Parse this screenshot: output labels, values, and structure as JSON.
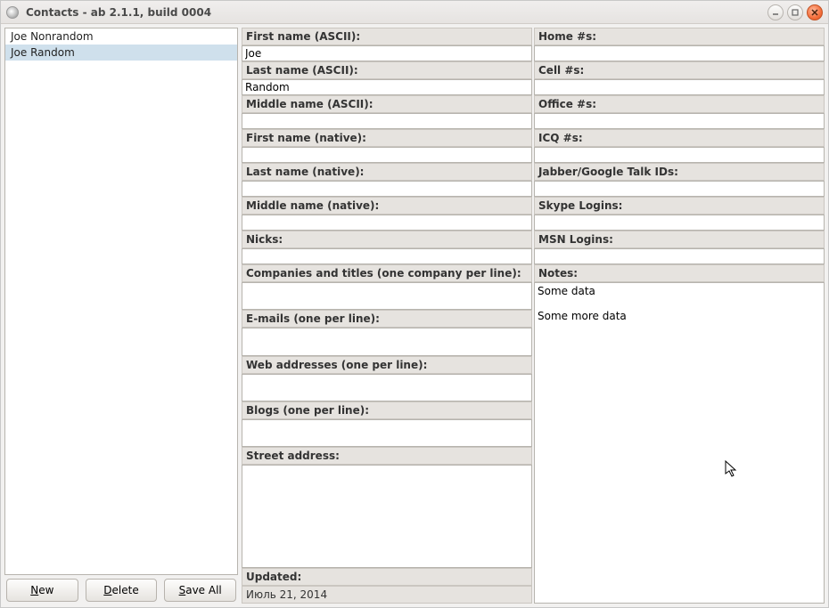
{
  "window": {
    "title": "Contacts - ab 2.1.1, build 0004"
  },
  "contacts": {
    "items": [
      {
        "name": "Joe Nonrandom",
        "selected": false
      },
      {
        "name": "Joe Random",
        "selected": true
      }
    ]
  },
  "buttons": {
    "new": "New",
    "delete": "Delete",
    "save_all": "Save All"
  },
  "labels": {
    "first_ascii": "First name (ASCII):",
    "last_ascii": "Last name (ASCII):",
    "middle_ascii": "Middle name (ASCII):",
    "first_native": "First name (native):",
    "last_native": "Last name (native):",
    "middle_native": "Middle name (native):",
    "nicks": "Nicks:",
    "companies": "Companies and titles (one company per line):",
    "emails": "E-mails (one per line):",
    "web": "Web addresses (one per line):",
    "blogs": "Blogs (one per line):",
    "street": "Street address:",
    "updated": "Updated:",
    "home": "Home #s:",
    "cell": "Cell #s:",
    "office": "Office #s:",
    "icq": "ICQ #s:",
    "jabber": "Jabber/Google Talk IDs:",
    "skype": "Skype Logins:",
    "msn": "MSN Logins:",
    "notes": "Notes:"
  },
  "values": {
    "first_ascii": "Joe",
    "last_ascii": "Random",
    "middle_ascii": "",
    "first_native": "",
    "last_native": "",
    "middle_native": "",
    "nicks": "",
    "companies": "",
    "emails": "",
    "web": "",
    "blogs": "",
    "street": "",
    "updated": "Июль 21, 2014",
    "home": "",
    "cell": "",
    "office": "",
    "icq": "",
    "jabber": "",
    "skype": "",
    "msn": "",
    "notes": "Some data\n\nSome more data"
  }
}
